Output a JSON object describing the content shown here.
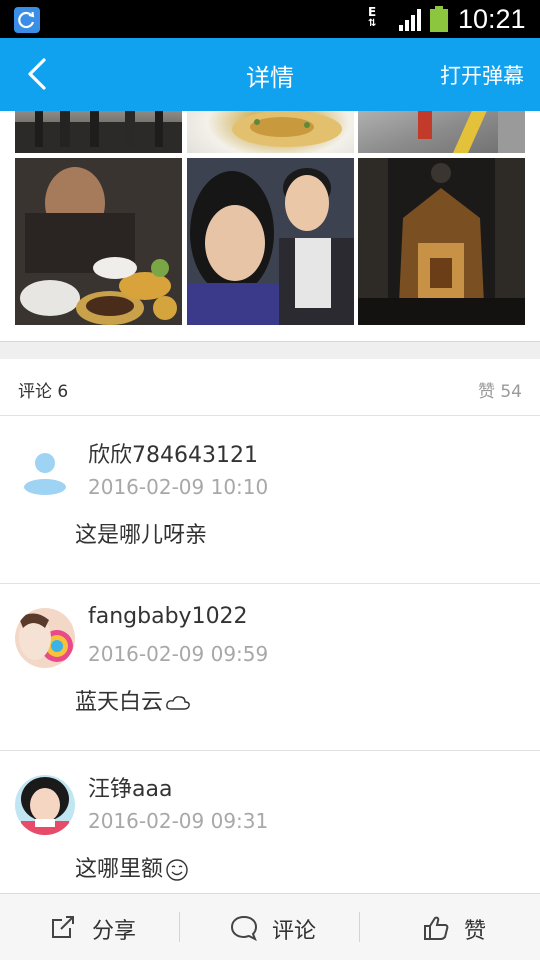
{
  "status_bar": {
    "network_label": "E",
    "time": "10:21",
    "app_icon": "refresh-icon",
    "signal_icon": "signal-bars-icon",
    "battery_icon": "battery-icon"
  },
  "header": {
    "back_icon": "chevron-left-icon",
    "title": "详情",
    "action_label": "打开弹幕"
  },
  "photos": [
    {
      "name": "street-photo"
    },
    {
      "name": "food-plate-photo"
    },
    {
      "name": "road-photo"
    },
    {
      "name": "dinner-photo"
    },
    {
      "name": "selfie-photo"
    },
    {
      "name": "cathedral-photo"
    }
  ],
  "comments_section": {
    "label": "评论 6",
    "likes_label": "赞 54"
  },
  "comments": [
    {
      "name": "欣欣784643121",
      "time": "2016-02-09 10:10",
      "text": "这是哪儿呀亲",
      "avatar": "default-user-icon"
    },
    {
      "name": "fangbaby1022",
      "time": "2016-02-09 09:59",
      "text": "蓝天白云",
      "emoji": "cloud-icon",
      "avatar": "user-avatar-lollipop"
    },
    {
      "name": "汪铮aaa",
      "time": "2016-02-09 09:31",
      "text": "这哪里额",
      "emoji": "smile-icon",
      "avatar": "user-avatar-girl"
    }
  ],
  "bottom_bar": {
    "share_label": "分享",
    "comment_label": "评论",
    "like_label": "赞",
    "share_icon": "share-icon",
    "comment_icon": "comment-bubble-icon",
    "like_icon": "thumbs-up-icon"
  },
  "colors": {
    "header_bg": "#11a2ef",
    "status_bg": "#000000",
    "battery": "#8cc63f"
  }
}
